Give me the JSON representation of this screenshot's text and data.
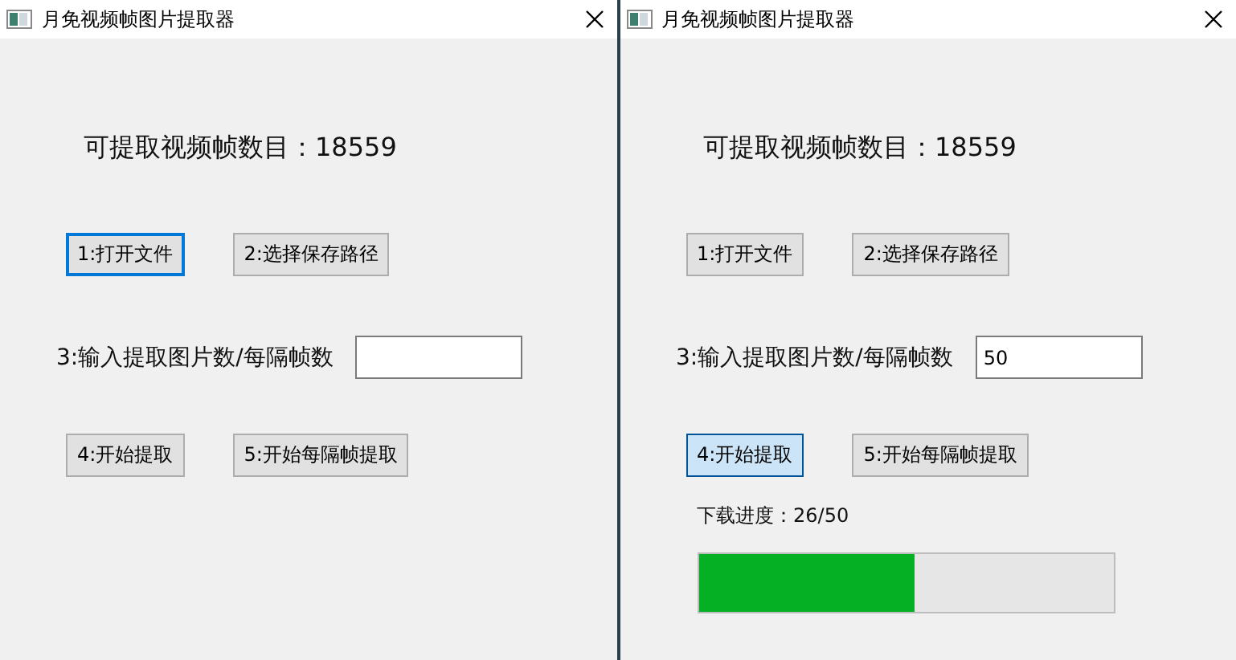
{
  "windows": [
    {
      "title": "月免视频帧图片提取器",
      "frame_count": "可提取视频帧数目：18559",
      "top_buttons": [
        {
          "label": "1:打开文件",
          "focused": true,
          "hovered": false
        },
        {
          "label": "2:选择保存路径",
          "focused": false,
          "hovered": false
        }
      ],
      "input_label": "3:输入提取图片数/每隔帧数",
      "bottom_buttons": [
        {
          "label": "4:开始提取",
          "focused": false,
          "hovered": false
        },
        {
          "label": "5:开始每隔帧提取",
          "focused": false,
          "hovered": false
        }
      ]
    },
    {
      "title": "月免视频帧图片提取器",
      "frame_count": "可提取视频帧数目：18559",
      "top_buttons": [
        {
          "label": "1:打开文件",
          "focused": false,
          "hovered": false
        },
        {
          "label": "2:选择保存路径",
          "focused": false,
          "hovered": false
        }
      ],
      "input_label": "3:输入提取图片数/每隔帧数",
      "input_value": "50",
      "bottom_buttons": [
        {
          "label": "4:开始提取",
          "focused": false,
          "hovered": true
        },
        {
          "label": "5:开始每隔帧提取",
          "focused": false,
          "hovered": false
        }
      ],
      "progress": {
        "label": "下载进度：26/50",
        "level": 0.52
      }
    }
  ]
}
